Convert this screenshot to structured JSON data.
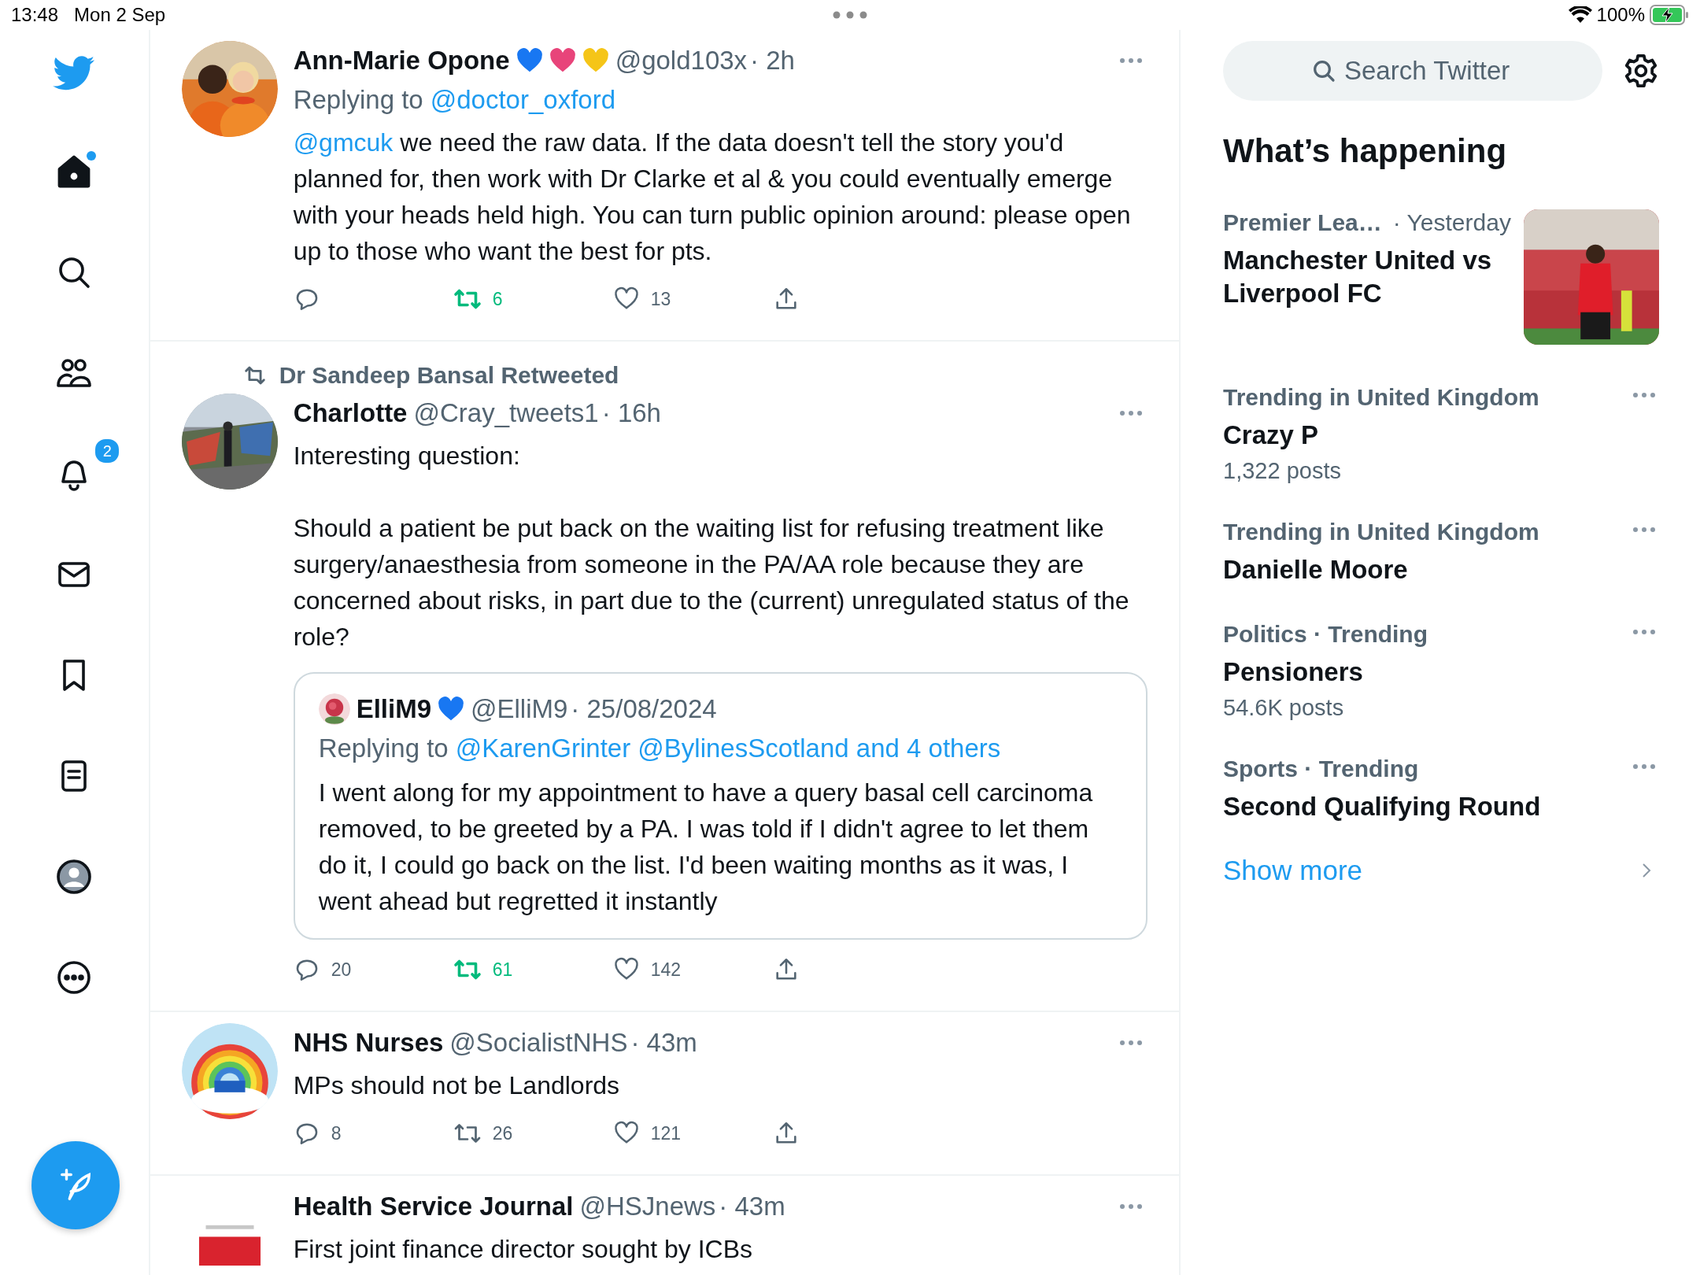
{
  "status_bar": {
    "time": "13:48",
    "date": "Mon 2 Sep",
    "battery": "100%"
  },
  "nav": {
    "items": [
      {
        "kind": "home",
        "selected": true,
        "unread": true
      },
      {
        "kind": "search",
        "selected": false
      },
      {
        "kind": "communities",
        "selected": false
      },
      {
        "kind": "notifications",
        "selected": false,
        "badge": "2"
      },
      {
        "kind": "messages",
        "selected": false
      },
      {
        "kind": "bookmarks",
        "selected": false
      },
      {
        "kind": "lists",
        "selected": false
      },
      {
        "kind": "profile",
        "selected": false
      },
      {
        "kind": "more",
        "selected": false
      }
    ]
  },
  "tweets": [
    {
      "name": "Ann-Marie Opone",
      "badges": [
        {
          "color": "#1877f2"
        },
        {
          "color": "#e8447a"
        },
        {
          "color": "#f5c518"
        }
      ],
      "handle": "@gold103x",
      "time": "· 2h",
      "replying_label": "Replying to",
      "replying_to": "@doctor_oxford",
      "mention": "@gmcuk",
      "paragraphs": [
        "we need the raw data. If the data doesn't tell the story you'd planned for, then work with Dr Clarke et al & you could eventually emerge with your heads held high. You can turn public opinion around: please open up to those who want the best for pts."
      ],
      "actions": {
        "retweets": "6",
        "likes": "13",
        "retweeted": true
      }
    },
    {
      "retweeted_by": "Dr Sandeep Bansal Retweeted",
      "name": "Charlotte",
      "handle": "@Cray_tweets1",
      "time": "· 16h",
      "paragraphs": [
        "Interesting question:",
        "Should a patient be put back on the waiting list for refusing treatment like surgery/anaesthesia from someone in the PA/AA role because they are concerned about risks, in part due to the (current) unregulated status of the role?"
      ],
      "quote": {
        "name": "ElliM9",
        "badges": [
          {
            "color": "#1877f2"
          }
        ],
        "handle": "@ElliM9",
        "time": "· 25/08/2024",
        "replying_label": "Replying to",
        "replying_to": "@KarenGrinter @BylinesScotland and 4 others",
        "text": "I went along for my appointment to have a query basal cell carcinoma removed, to be greeted by a PA. I was told if I didn't agree to let them do it, I could go back on the list. I'd been waiting months as it was, I went ahead but regretted it instantly"
      },
      "actions": {
        "replies": "20",
        "retweets": "61",
        "likes": "142",
        "retweeted": true
      }
    },
    {
      "name": "NHS Nurses",
      "handle": "@SocialistNHS",
      "time": "· 43m",
      "paragraphs": [
        "MPs should not be Landlords"
      ],
      "actions": {
        "replies": "8",
        "retweets": "26",
        "likes": "121",
        "retweeted": false
      }
    },
    {
      "name": "Health Service Journal",
      "handle": "@HSJnews",
      "time": "· 43m",
      "paragraphs": [
        "First joint finance director sought by ICBs"
      ]
    }
  ],
  "sidebar": {
    "search": {
      "placeholder": "Search Twitter"
    },
    "title": "What’s happening",
    "trends": [
      {
        "category": "Premier Lea…",
        "time": "· Yesterday",
        "title": "Manchester United vs Liverpool FC"
      },
      {
        "kind": "trend",
        "category": "Trending in United Kingdom",
        "title": "Crazy P",
        "posts": "1,322 posts"
      },
      {
        "kind": "trend",
        "category": "Trending in United Kingdom",
        "title": "Danielle Moore"
      },
      {
        "kind": "trend",
        "category": "Politics · Trending",
        "title": "Pensioners",
        "posts": "54.6K posts"
      },
      {
        "kind": "trend",
        "category": "Sports · Trending",
        "title": "Second Qualifying Round"
      }
    ],
    "show_more": "Show more"
  }
}
